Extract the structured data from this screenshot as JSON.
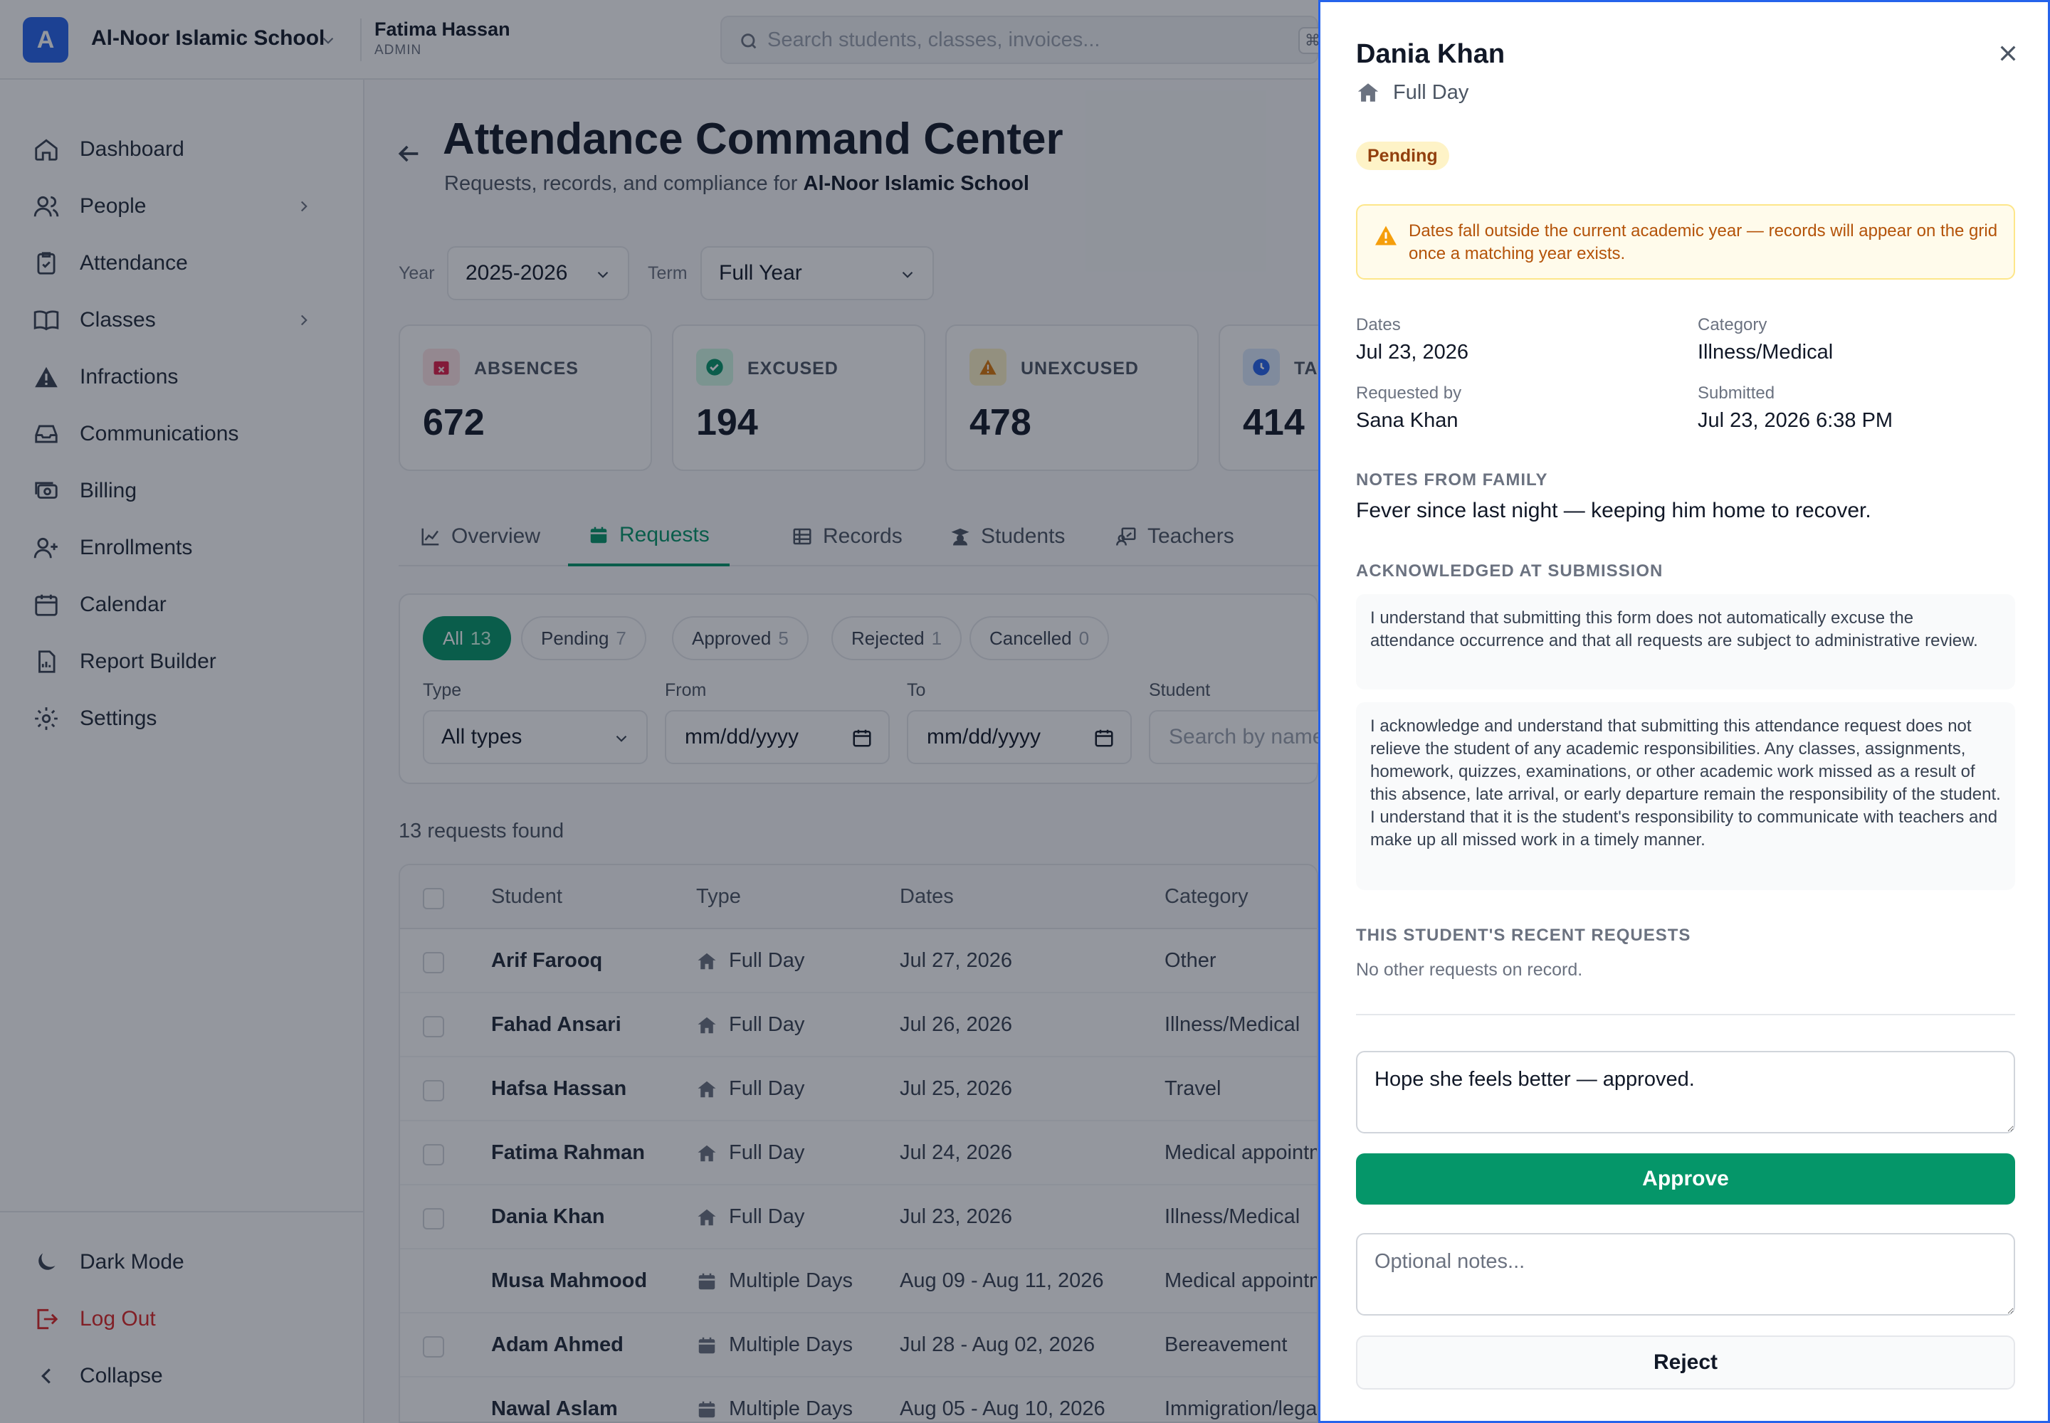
{
  "topbar": {
    "school_initial": "A",
    "school_name": "Al-Noor Islamic School",
    "user_name": "Fatima Hassan",
    "user_role": "ADMIN",
    "search_placeholder": "Search students, classes, invoices...",
    "search_shortcut": "⌘"
  },
  "sidebar": {
    "items": [
      {
        "label": "Dashboard",
        "icon": "home-icon"
      },
      {
        "label": "People",
        "icon": "users-icon"
      },
      {
        "label": "Attendance",
        "icon": "clipboard-check-icon"
      },
      {
        "label": "Classes",
        "icon": "book-icon"
      },
      {
        "label": "Infractions",
        "icon": "alert-triangle-icon"
      },
      {
        "label": "Communications",
        "icon": "inbox-icon"
      },
      {
        "label": "Billing",
        "icon": "money-icon"
      },
      {
        "label": "Enrollments",
        "icon": "user-plus-icon"
      },
      {
        "label": "Calendar",
        "icon": "calendar-icon"
      },
      {
        "label": "Report Builder",
        "icon": "report-icon"
      },
      {
        "label": "Settings",
        "icon": "gear-icon"
      }
    ],
    "dark_mode": "Dark Mode",
    "logout": "Log Out",
    "collapse": "Collapse"
  },
  "page": {
    "title": "Attendance Command Center",
    "subtitle_prefix": "Requests, records, and compliance for ",
    "subtitle_school": "Al-Noor Islamic School",
    "year_label": "Year",
    "year_value": "2025-2026",
    "term_label": "Term",
    "term_value": "Full Year"
  },
  "stats": [
    {
      "label": "ABSENCES",
      "value": "672",
      "color": "#e11d48",
      "bg": "#ffe4e6"
    },
    {
      "label": "EXCUSED",
      "value": "194",
      "color": "#059669",
      "bg": "#d1fae5"
    },
    {
      "label": "UNEXCUSED",
      "value": "478",
      "color": "#d97706",
      "bg": "#fef3c7"
    },
    {
      "label": "TARDIES",
      "value": "414",
      "color": "#2563eb",
      "bg": "#dbeafe"
    }
  ],
  "tabs": [
    {
      "label": "Overview"
    },
    {
      "label": "Requests"
    },
    {
      "label": "Records"
    },
    {
      "label": "Students"
    },
    {
      "label": "Teachers"
    }
  ],
  "chips": [
    {
      "label": "All",
      "count": "13"
    },
    {
      "label": "Pending",
      "count": "7"
    },
    {
      "label": "Approved",
      "count": "5"
    },
    {
      "label": "Rejected",
      "count": "1"
    },
    {
      "label": "Cancelled",
      "count": "0"
    }
  ],
  "filters": {
    "type_label": "Type",
    "type_value": "All types",
    "from_label": "From",
    "from_value": "mm/dd/yyyy",
    "to_label": "To",
    "to_value": "mm/dd/yyyy",
    "student_label": "Student",
    "student_placeholder": "Search by name..."
  },
  "results_text": "13 requests found",
  "table": {
    "headers": {
      "student": "Student",
      "type": "Type",
      "dates": "Dates",
      "category": "Category"
    },
    "rows": [
      {
        "student": "Arif Farooq",
        "type": "Full Day",
        "dates": "Jul 27, 2026",
        "category": "Other"
      },
      {
        "student": "Fahad Ansari",
        "type": "Full Day",
        "dates": "Jul 26, 2026",
        "category": "Illness/Medical"
      },
      {
        "student": "Hafsa Hassan",
        "type": "Full Day",
        "dates": "Jul 25, 2026",
        "category": "Travel"
      },
      {
        "student": "Fatima Rahman",
        "type": "Full Day",
        "dates": "Jul 24, 2026",
        "category": "Medical appointment"
      },
      {
        "student": "Dania Khan",
        "type": "Full Day",
        "dates": "Jul 23, 2026",
        "category": "Illness/Medical"
      },
      {
        "student": "Musa Mahmood",
        "type": "Multiple Days",
        "dates": "Aug 09 - Aug 11, 2026",
        "category": "Medical appointment"
      },
      {
        "student": "Adam Ahmed",
        "type": "Multiple Days",
        "dates": "Jul 28 - Aug 02, 2026",
        "category": "Bereavement"
      },
      {
        "student": "Nawal Aslam",
        "type": "Multiple Days",
        "dates": "Aug 05 - Aug 10, 2026",
        "category": "Immigration/legal"
      }
    ]
  },
  "drawer": {
    "student_name": "Dania Khan",
    "type": "Full Day",
    "status": "Pending",
    "warning": "Dates fall outside the current academic year — records will appear on the grid once a matching year exists.",
    "dates_label": "Dates",
    "dates_value": "Jul 23, 2026",
    "category_label": "Category",
    "category_value": "Illness/Medical",
    "requested_by_label": "Requested by",
    "requested_by_value": "Sana Khan",
    "submitted_label": "Submitted",
    "submitted_value": "Jul 23, 2026 6:38 PM",
    "notes_heading": "NOTES FROM FAMILY",
    "notes_text": "Fever since last night — keeping him home to recover.",
    "ack_heading": "ACKNOWLEDGED AT SUBMISSION",
    "ack_1": "I understand that submitting this form does not automatically excuse the attendance occurrence and that all requests are subject to administrative review.",
    "ack_2": "I acknowledge and understand that submitting this attendance request does not relieve the student of any academic responsibilities. Any classes, assignments, homework, quizzes, examinations, or other academic work missed as a result of this absence, late arrival, or early departure remain the responsibility of the student. I understand that it is the student's responsibility to communicate with teachers and make up all missed work in a timely manner.",
    "recent_heading": "THIS STUDENT'S RECENT REQUESTS",
    "recent_empty": "No other requests on record.",
    "approve_notes_value": "Hope she feels better — approved.",
    "approve_label": "Approve",
    "reject_notes_placeholder": "Optional notes...",
    "reject_label": "Reject"
  },
  "colors": {
    "primary_green": "#059669",
    "brand_blue": "#2563eb",
    "warning_amber": "#b45309",
    "danger_red": "#dc2626"
  }
}
